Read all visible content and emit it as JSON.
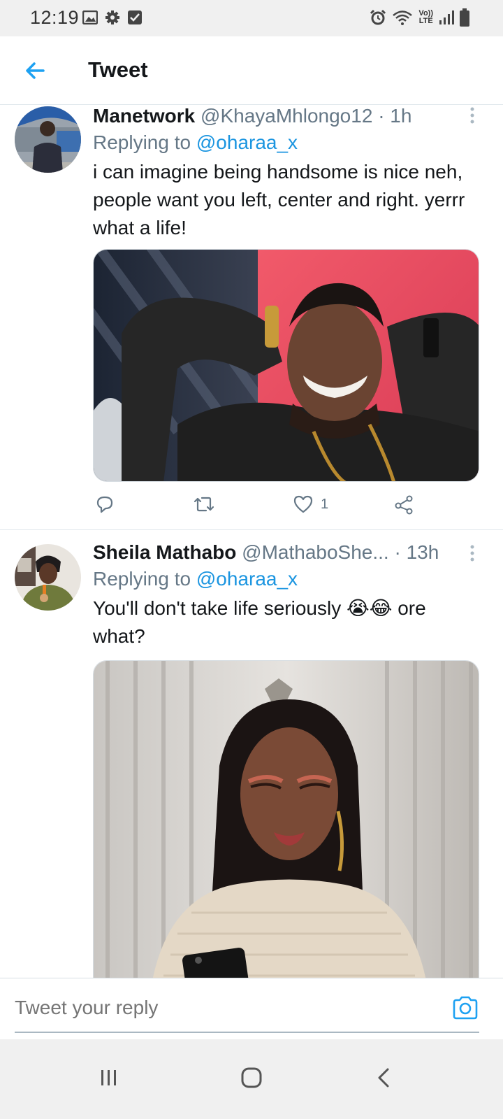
{
  "status_bar": {
    "time": "12:19",
    "left_icons": [
      "image-icon",
      "gear-icon",
      "checkbox-icon"
    ],
    "right_icons": [
      "alarm-icon",
      "wifi-icon",
      "volte-icon",
      "signal-icon",
      "battery-icon"
    ],
    "volte_top": "Vo))",
    "volte_bottom": "LTE"
  },
  "header": {
    "title": "Tweet",
    "back_icon": "arrow-left-icon",
    "accent_color": "#1da1f2"
  },
  "tweets": [
    {
      "name": "Manetwork",
      "handle": "@KhayaMhlongo12",
      "separator": "·",
      "time": "1h",
      "replying_prefix": "Replying to",
      "replying_to": "@oharaa_x",
      "text": "i can imagine being handsome is nice neh, people want you left, center and right. yerrr what a life!",
      "media": "photo of a smiling man in black sweater with hands behind head",
      "actions": {
        "reply_icon": "reply-icon",
        "retweet_icon": "retweet-icon",
        "like_icon": "heart-icon",
        "like_count": "1",
        "share_icon": "share-icon"
      }
    },
    {
      "name": "Sheila Mathabo",
      "handle": "@MathaboShe...",
      "separator": "·",
      "time": "13h",
      "replying_prefix": "Replying to",
      "replying_to": "@oharaa_x",
      "text": "You'll don't take life seriously 😭😂 ore what?",
      "media": "photo of a woman in knit sweater looking at phone"
    }
  ],
  "composer": {
    "placeholder": "Tweet your reply",
    "camera_icon": "camera-icon"
  },
  "nav_bar": {
    "buttons": [
      "recents-icon",
      "home-icon",
      "back-icon"
    ]
  }
}
